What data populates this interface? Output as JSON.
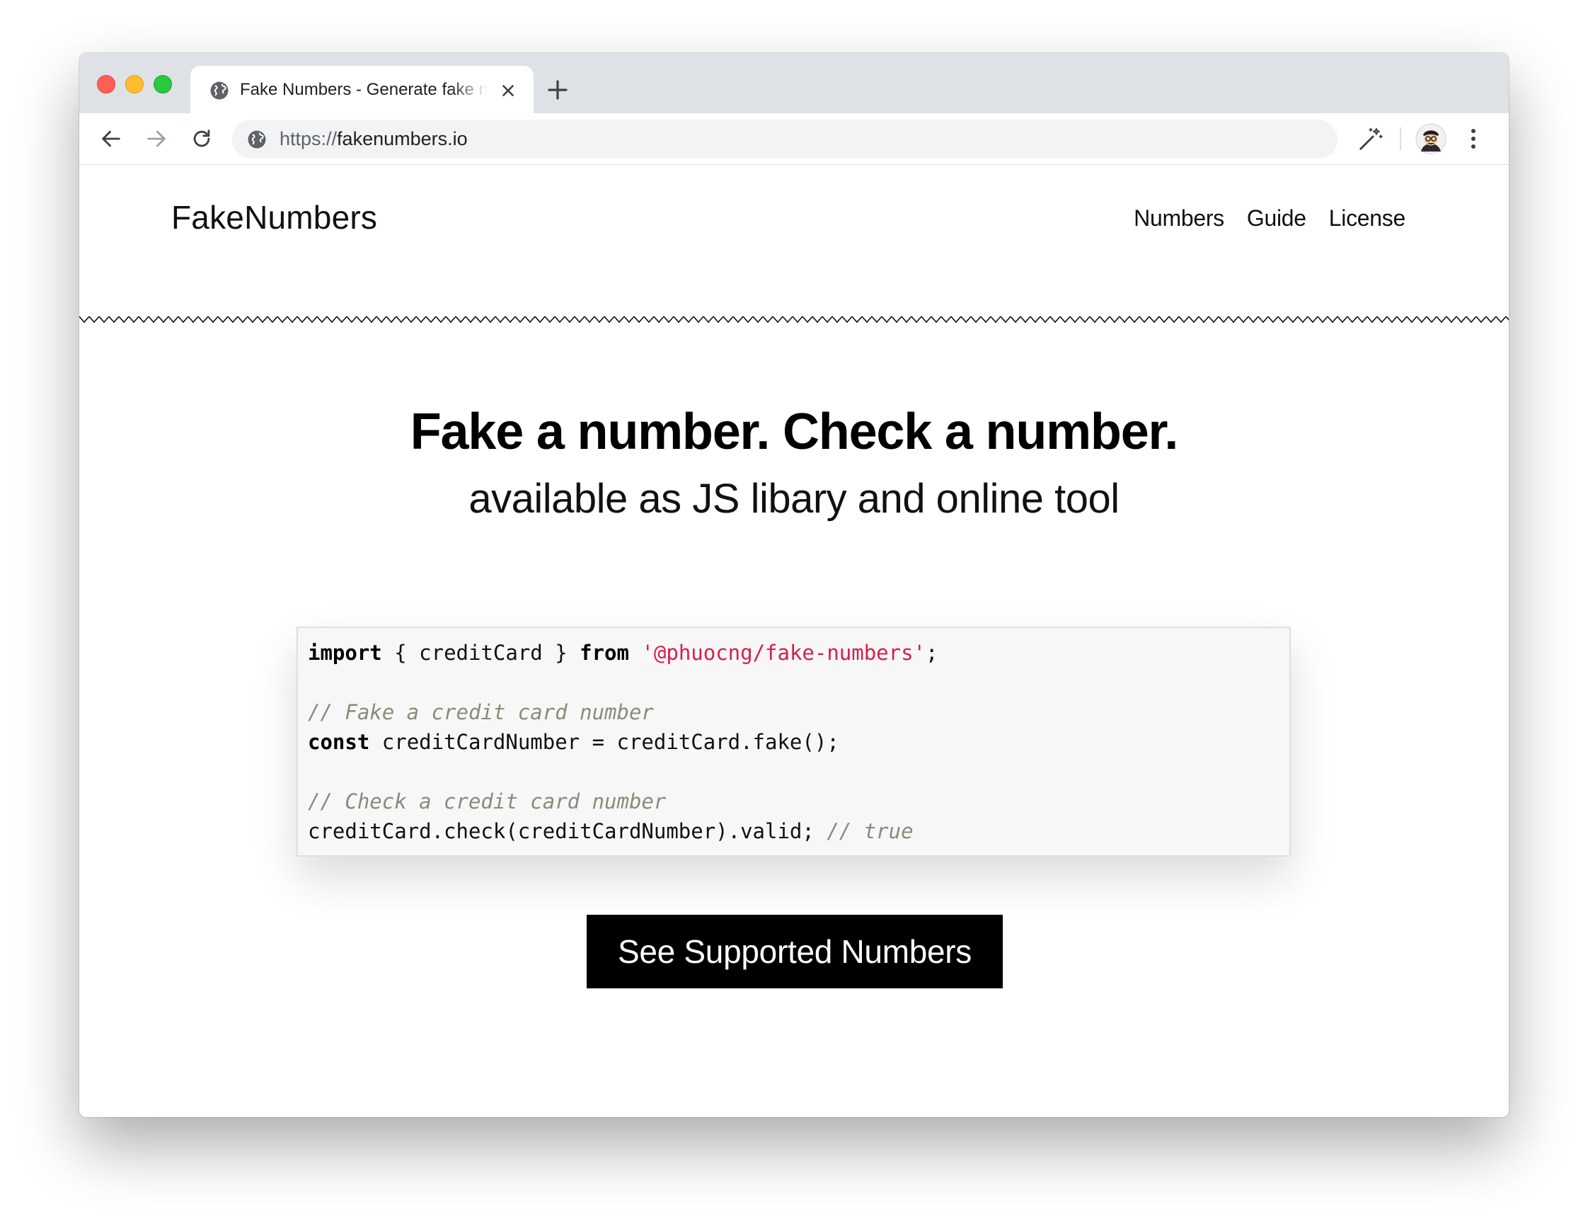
{
  "browser": {
    "tab": {
      "title": "Fake Numbers - Generate fake numbers"
    },
    "url": {
      "scheme": "https://",
      "host": "fakenumbers.io"
    }
  },
  "site": {
    "logo": "FakeNumbers",
    "nav": [
      {
        "label": "Numbers"
      },
      {
        "label": "Guide"
      },
      {
        "label": "License"
      }
    ]
  },
  "hero": {
    "title": "Fake a number. Check a number.",
    "subtitle": "available as JS libary and online tool"
  },
  "code_example": {
    "import_kw": "import",
    "import_names": " { creditCard } ",
    "from_kw": "from",
    "module": "'@phuocng/fake-numbers'",
    "import_end": ";",
    "comment_fake": "// Fake a credit card number",
    "const_kw": "const",
    "fake_stmt": " creditCardNumber = creditCard.fake();",
    "comment_check": "// Check a credit card number",
    "check_stmt": "creditCard.check(creditCardNumber).valid; ",
    "check_result": "// true"
  },
  "cta": {
    "label": "See Supported Numbers"
  },
  "colors": {
    "string": "#d6204b",
    "comment": "#8b8b7b",
    "button_bg": "#000000"
  }
}
